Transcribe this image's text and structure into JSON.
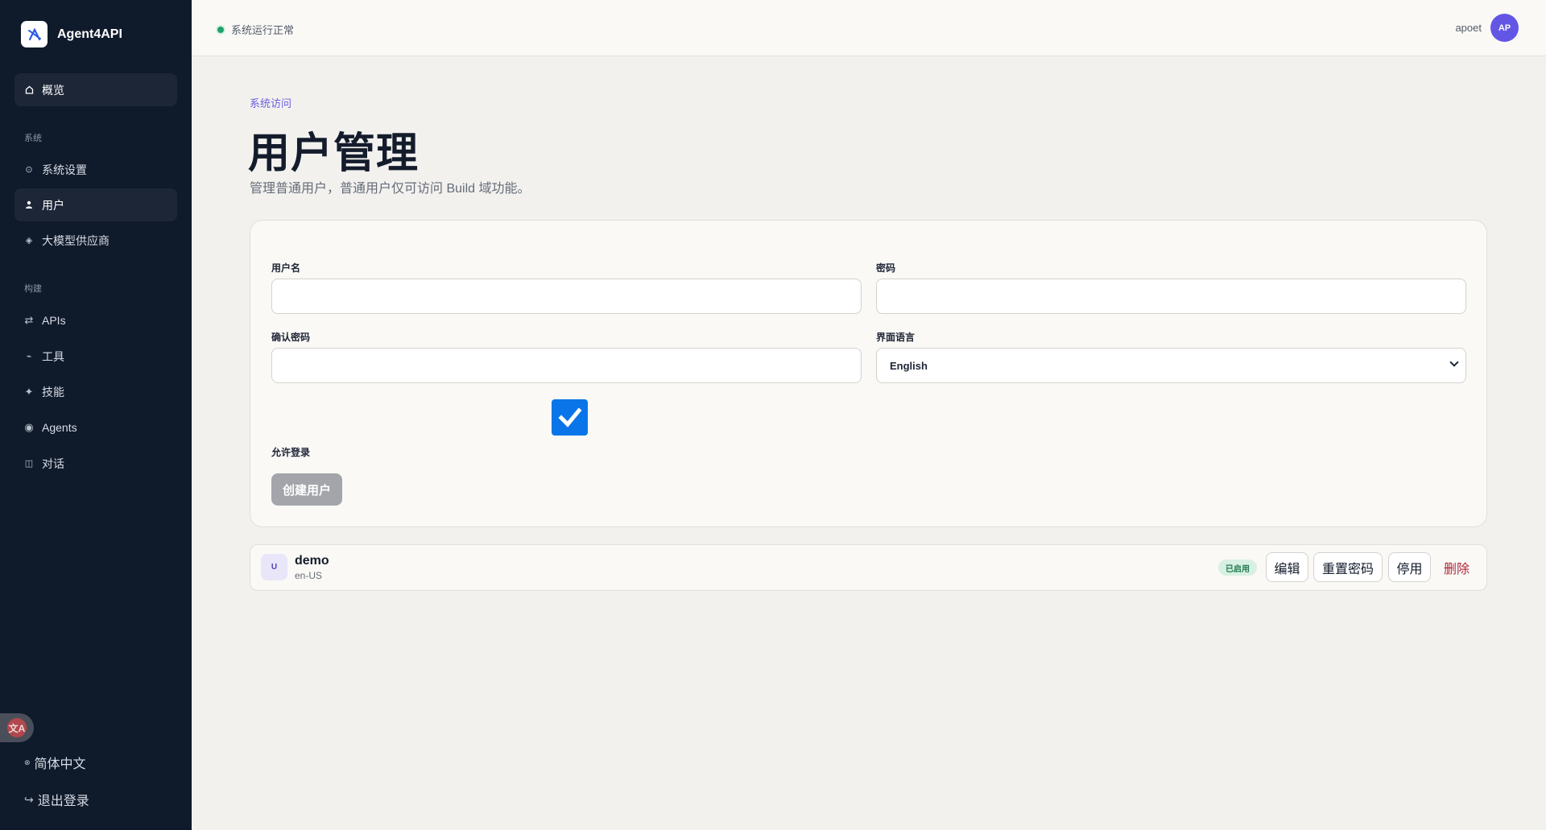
{
  "app": {
    "name": "Agent4API"
  },
  "sidebar": {
    "overview": {
      "label": "概览",
      "icon": "home-icon"
    },
    "section_system": "系统",
    "system_items": [
      {
        "label": "系统设置",
        "icon": "settings-icon"
      },
      {
        "label": "用户",
        "icon": "user-icon",
        "active": true
      },
      {
        "label": "大模型供应商",
        "icon": "diamond-icon"
      }
    ],
    "section_build": "构建",
    "build_items": [
      {
        "label": "APIs",
        "icon": "swap-arrows-icon"
      },
      {
        "label": "工具",
        "icon": "tool-icon"
      },
      {
        "label": "技能",
        "icon": "sparkle-icon"
      },
      {
        "label": "Agents",
        "icon": "agent-icon"
      },
      {
        "label": "对话",
        "icon": "chat-icon"
      }
    ],
    "translate_icon": "translate-icon",
    "language": "简体中文",
    "logout": "退出登录"
  },
  "topbar": {
    "status": "系统运行正常",
    "username": "apoet",
    "avatar_initials": "AP"
  },
  "page": {
    "eyebrow": "系统访问",
    "title": "用户管理",
    "description": "管理普通用户，普通用户仅可访问 Build 域功能。"
  },
  "form": {
    "username_label": "用户名",
    "username_value": "",
    "password_label": "密码",
    "password_value": "",
    "confirm_label": "确认密码",
    "confirm_value": "",
    "language_label": "界面语言",
    "language_value": "English",
    "allow_login_label": "允许登录",
    "allow_login_checked": true,
    "create_button": "创建用户"
  },
  "users": [
    {
      "initial": "U",
      "name": "demo",
      "locale": "en-US",
      "status": "已启用",
      "actions": {
        "edit": "编辑",
        "reset_password": "重置密码",
        "disable": "停用",
        "delete": "删除"
      }
    }
  ],
  "colors": {
    "sidebar_bg": "#0f1a2b",
    "accent": "#6356e5",
    "checkbox": "#0a75e8",
    "status_ok": "#22a06b",
    "danger": "#b0283a"
  }
}
